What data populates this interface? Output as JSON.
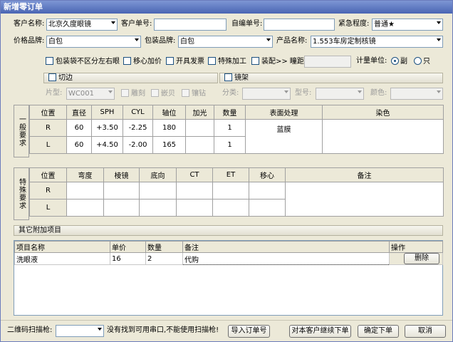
{
  "window": {
    "title": "新增零订单"
  },
  "row1": {
    "customer_label": "客户名称:",
    "customer_value": "北京久度眼镜",
    "order_no_label": "客户单号:",
    "order_no_value": "",
    "self_no_label": "自编单号:",
    "self_no_value": "",
    "urgency_label": "紧急程度:",
    "urgency_value": "普通★"
  },
  "row2": {
    "price_brand_label": "价格品牌:",
    "price_brand_value": "白包",
    "pack_brand_label": "包装品牌:",
    "pack_brand_value": "白包",
    "product_label": "产品名称:",
    "product_value": "1.553车房定制核镜"
  },
  "options": {
    "no_lr": "包装袋不区分左右眼",
    "shift_price": "移心加价",
    "invoice": "开具发票",
    "special": "特殊加工",
    "assemble": "装配>> 瞳距",
    "pd_value": "",
    "unit_label": "计量单位:",
    "unit_pair": "副",
    "unit_piece": "只"
  },
  "edging": {
    "label": "切边",
    "type_label": "片型:",
    "type_value": "WC001",
    "carve": "雕刻",
    "inlay": "嵌贝",
    "drill": "镶钻"
  },
  "frame": {
    "label": "镜架",
    "category_label": "分类:",
    "model_label": "型号:",
    "color_label": "颜色:"
  },
  "general": {
    "side_label": "一般要求",
    "headers": [
      "位置",
      "直径",
      "SPH",
      "CYL",
      "轴位",
      "加光",
      "数量",
      "表面处理",
      "染色"
    ],
    "rows": [
      {
        "pos": "R",
        "dia": "60",
        "sph": "+3.50",
        "cyl": "-2.25",
        "axis": "180",
        "add": "",
        "qty": "1"
      },
      {
        "pos": "L",
        "dia": "60",
        "sph": "+4.50",
        "cyl": "-2.00",
        "axis": "165",
        "add": "",
        "qty": "1"
      }
    ],
    "surface": "蓝膜",
    "tint": ""
  },
  "special_req": {
    "side_label": "特殊要求",
    "headers": [
      "位置",
      "弯度",
      "棱镜",
      "底向",
      "CT",
      "ET",
      "移心",
      "备注"
    ],
    "rows": [
      {
        "pos": "R"
      },
      {
        "pos": "L"
      }
    ]
  },
  "extra": {
    "section_label": "其它附加项目",
    "headers": [
      "项目名称",
      "单价",
      "数量",
      "备注",
      "操作"
    ],
    "rows": [
      {
        "name": "洗眼液",
        "price": "16",
        "qty": "2",
        "note": "代购",
        "action": "删除"
      }
    ]
  },
  "footer": {
    "scanner_label": "二维码扫描枪:",
    "scanner_value": "",
    "scanner_msg": "没有找到可用串口,不能使用扫描枪!",
    "import_btn": "导入订单号",
    "continue_btn": "对本客户继续下单",
    "confirm_btn": "确定下单",
    "cancel_btn": "取消"
  }
}
